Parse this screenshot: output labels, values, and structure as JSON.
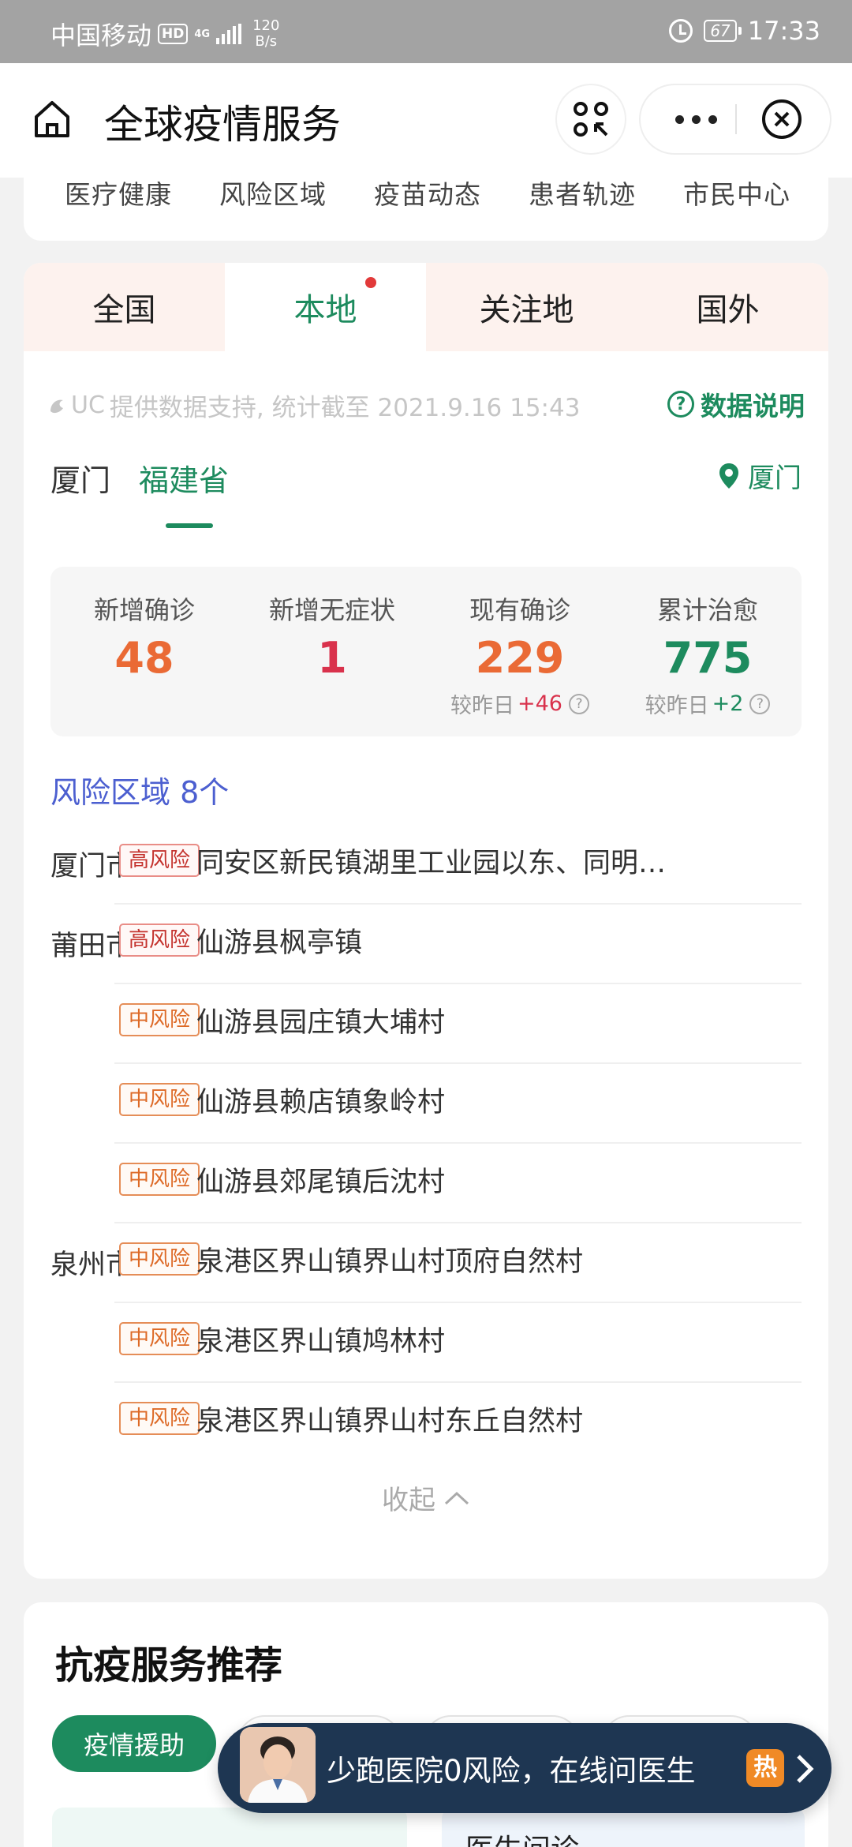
{
  "status_bar": {
    "carrier": "中国移动",
    "hd": "HD",
    "signal_type": "4G",
    "speed_value": "120",
    "speed_unit": "B/s",
    "battery": "67",
    "time": "17:33"
  },
  "title_bar": {
    "title": "全球疫情服务"
  },
  "top_nav": [
    "医疗健康",
    "风险区域",
    "疫苗动态",
    "患者轨迹",
    "市民中心"
  ],
  "tabs": [
    {
      "label": "全国",
      "active": false
    },
    {
      "label": "本地",
      "active": true
    },
    {
      "label": "关注地",
      "active": false
    },
    {
      "label": "国外",
      "active": false
    }
  ],
  "source": {
    "logo": "UC",
    "text": "提供数据支持, 统计截至 2021.9.16 15:43",
    "help_label": "数据说明"
  },
  "region_tabs": {
    "city": "厦门",
    "province": "福建省",
    "location": "厦门"
  },
  "stats": [
    {
      "label": "新增确诊",
      "value": "48",
      "color": "#ea6a35",
      "delta_prefix": "",
      "delta": ""
    },
    {
      "label": "新增无症状",
      "value": "1",
      "color": "#d9324c",
      "delta_prefix": "",
      "delta": ""
    },
    {
      "label": "现有确诊",
      "value": "229",
      "color": "#ea6a35",
      "delta_prefix": "较昨日",
      "delta": "+46",
      "delta_color": "#d9324c"
    },
    {
      "label": "累计治愈",
      "value": "775",
      "color": "#1d8b5e",
      "delta_prefix": "较昨日",
      "delta": "+2",
      "delta_color": "#1d8b5e"
    }
  ],
  "risk_area": {
    "title": "风险区域",
    "count": "8个",
    "rows": [
      {
        "city": "厦门市",
        "level": "高风险",
        "severity": "high",
        "place": "同安区新民镇湖里工业园以东、同明…"
      },
      {
        "city": "莆田市",
        "level": "高风险",
        "severity": "high",
        "place": "仙游县枫亭镇"
      },
      {
        "city": "",
        "level": "中风险",
        "severity": "mid",
        "place": "仙游县园庄镇大埔村"
      },
      {
        "city": "",
        "level": "中风险",
        "severity": "mid",
        "place": "仙游县赖店镇象岭村"
      },
      {
        "city": "",
        "level": "中风险",
        "severity": "mid",
        "place": "仙游县郊尾镇后沈村"
      },
      {
        "city": "泉州市",
        "level": "中风险",
        "severity": "mid",
        "place": "泉港区界山镇界山村顶府自然村"
      },
      {
        "city": "",
        "level": "中风险",
        "severity": "mid",
        "place": "泉港区界山镇鸠林村"
      },
      {
        "city": "",
        "level": "中风险",
        "severity": "mid",
        "place": "泉港区界山镇界山村东丘自然村"
      }
    ],
    "collapse_label": "收起"
  },
  "services": {
    "title": "抗疫服务推荐",
    "chips": [
      "疫情援助",
      "",
      "",
      ""
    ],
    "card2_text": "医生问诊"
  },
  "float_ad": {
    "text": "少跑医院0风险，在线问医生",
    "hot": "热"
  },
  "colors": {
    "brand_green": "#1d8b5e",
    "risk_blue": "#4c5fd0"
  }
}
